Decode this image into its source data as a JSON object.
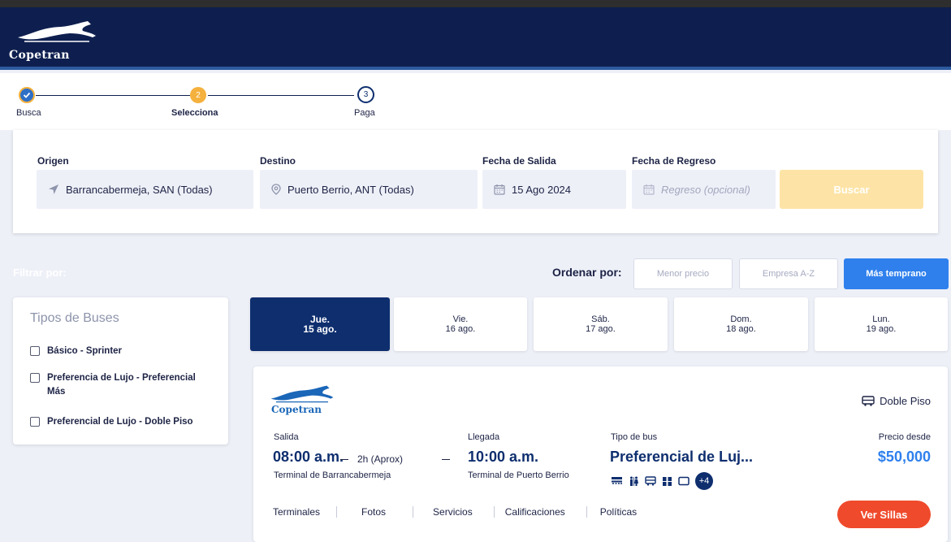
{
  "header": {
    "brand": "Copetran"
  },
  "stepper": {
    "steps": [
      {
        "number": "✓",
        "label": "Busca",
        "state": "done"
      },
      {
        "number": "2",
        "label": "Selecciona",
        "state": "current"
      },
      {
        "number": "3",
        "label": "Paga",
        "state": "pending"
      }
    ]
  },
  "search": {
    "origin_label": "Origen",
    "origin_value": "Barrancabermeja, SAN (Todas)",
    "destination_label": "Destino",
    "destination_value": "Puerto Berrio, ANT (Todas)",
    "departure_label": "Fecha de Salida",
    "departure_value": "15 Ago 2024",
    "return_label": "Fecha de Regreso",
    "return_placeholder": "Regreso (opcional)",
    "search_button": "Buscar"
  },
  "filters": {
    "title": "Filtrar por:",
    "bus_types_title": "Tipos de Buses",
    "bus_types": [
      "Básico - Sprinter",
      "Preferencia de Lujo - Preferencial Más",
      "Preferencial de Lujo - Doble Piso"
    ]
  },
  "sort": {
    "label": "Ordenar por:",
    "options": [
      "Menor precio",
      "Empresa A-Z",
      "Más temprano"
    ],
    "active": "Más temprano"
  },
  "dates": [
    {
      "day": "Jue.",
      "date": "15 ago.",
      "active": true
    },
    {
      "day": "Vie.",
      "date": "16 ago.",
      "active": false
    },
    {
      "day": "Sáb.",
      "date": "17 ago.",
      "active": false
    },
    {
      "day": "Dom.",
      "date": "18 ago.",
      "active": false
    },
    {
      "day": "Lun.",
      "date": "19 ago.",
      "active": false
    }
  ],
  "result": {
    "brand": "Copetran",
    "bus_kind": "Doble Piso",
    "departure_label": "Salida",
    "departure_time": "08:00 a.m.",
    "duration": "2h (Aprox)",
    "arrival_label": "Llegada",
    "arrival_time": "10:00 a.m.",
    "departure_terminal": "Terminal de Barrancabermeja",
    "arrival_terminal": "Terminal de Puerto Berrio",
    "bus_type_label": "Tipo de bus",
    "bus_type": "Preferencial de Luj...",
    "amenities_more": "+4",
    "price_label": "Precio desde",
    "price": "$50,000",
    "tabs": [
      "Terminales",
      "Fotos",
      "Servicios",
      "Calificaciones",
      "Políticas"
    ],
    "action_button": "Ver Sillas"
  },
  "colors": {
    "header_bg": "#0e1f4f",
    "accent_blue": "#2f80ed",
    "step_current": "#f5b13d",
    "cta_red": "#ef4a2c",
    "active_date": "#0e2e6e"
  }
}
